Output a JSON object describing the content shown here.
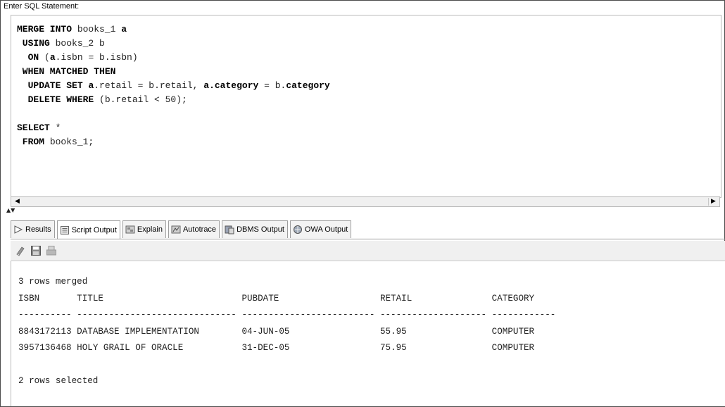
{
  "header": {
    "label": "Enter SQL Statement:"
  },
  "sql_lines": [
    [
      {
        "t": "MERGE INTO",
        "kw": true
      },
      {
        "t": " books_1 ",
        "kw": false
      },
      {
        "t": "a",
        "kw": true
      }
    ],
    [
      {
        "t": " USING",
        "kw": true
      },
      {
        "t": " books_2 b",
        "kw": false
      }
    ],
    [
      {
        "t": "  ON",
        "kw": true
      },
      {
        "t": " (",
        "kw": false
      },
      {
        "t": "a",
        "kw": true
      },
      {
        "t": ".isbn = b.isbn)",
        "kw": false
      }
    ],
    [
      {
        "t": " WHEN MATCHED THEN",
        "kw": true
      }
    ],
    [
      {
        "t": "  UPDATE SET",
        "kw": true
      },
      {
        "t": " ",
        "kw": false
      },
      {
        "t": "a",
        "kw": true
      },
      {
        "t": ".retail = b.retail, ",
        "kw": false
      },
      {
        "t": "a.category",
        "kw": true
      },
      {
        "t": " = b.",
        "kw": false
      },
      {
        "t": "category",
        "kw": true
      }
    ],
    [
      {
        "t": "  DELETE WHERE",
        "kw": true
      },
      {
        "t": " (b.retail < 50);",
        "kw": false
      }
    ],
    [],
    [
      {
        "t": "SELECT",
        "kw": true
      },
      {
        "t": " *",
        "kw": false
      }
    ],
    [
      {
        "t": " FROM",
        "kw": true
      },
      {
        "t": " books_1;",
        "kw": false
      }
    ]
  ],
  "tabs": [
    {
      "label": "Results",
      "icon": "play-arrow-icon",
      "active": false
    },
    {
      "label": "Script Output",
      "icon": "script-output-icon",
      "active": true
    },
    {
      "label": "Explain",
      "icon": "explain-icon",
      "active": false
    },
    {
      "label": "Autotrace",
      "icon": "autotrace-icon",
      "active": false
    },
    {
      "label": "DBMS Output",
      "icon": "dbms-output-icon",
      "active": false
    },
    {
      "label": "OWA Output",
      "icon": "owa-output-icon",
      "active": false
    }
  ],
  "toolbar": {
    "buttons": [
      "eraser-icon",
      "save-icon",
      "print-icon"
    ]
  },
  "output": {
    "merged_msg": "3 rows merged",
    "columns": [
      "ISBN",
      "TITLE",
      "PUBDATE",
      "RETAIL",
      "CATEGORY"
    ],
    "separators": [
      "----------",
      "------------------------------",
      "-------------------------",
      "--------------------",
      "------------"
    ],
    "rows": [
      [
        "8843172113",
        "DATABASE IMPLEMENTATION",
        "04-JUN-05",
        "55.95",
        "COMPUTER"
      ],
      [
        "3957136468",
        "HOLY GRAIL OF ORACLE",
        "31-DEC-05",
        "75.95",
        "COMPUTER"
      ]
    ],
    "selected_msg": "2 rows selected"
  }
}
